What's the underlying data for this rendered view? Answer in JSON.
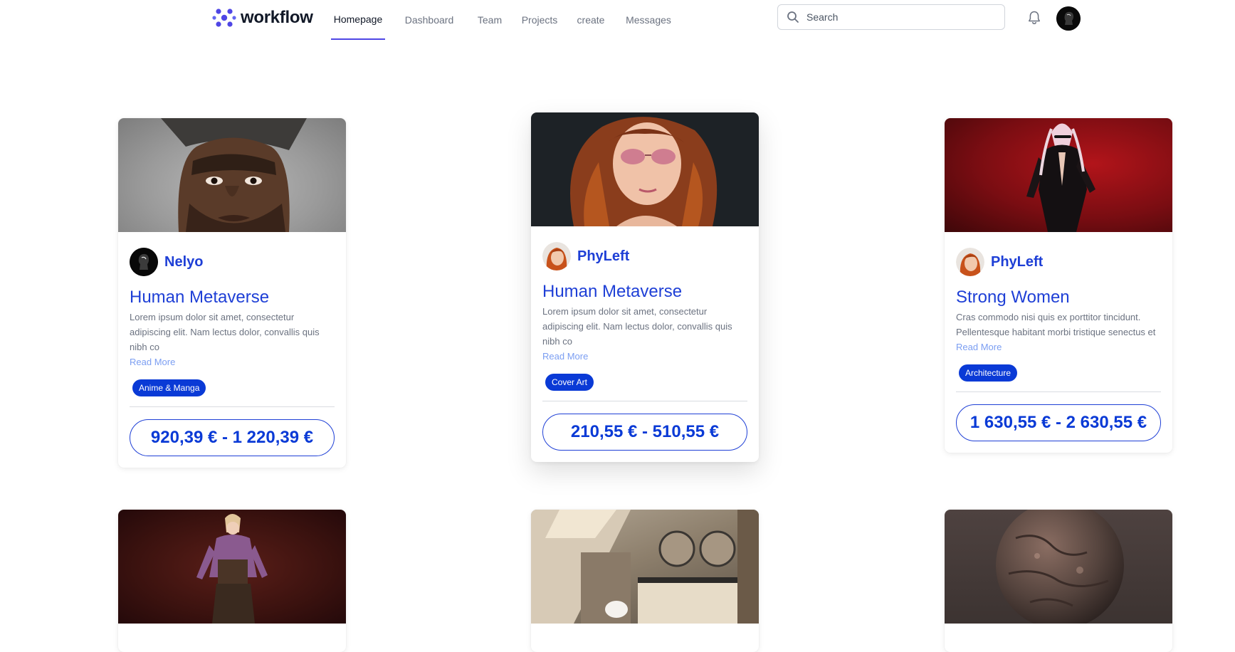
{
  "brand": {
    "name": "workflow",
    "accent": "#4f46e5"
  },
  "nav": {
    "links": [
      {
        "label": "Homepage",
        "active": true
      },
      {
        "label": "Dashboard",
        "active": false
      },
      {
        "label": "Team",
        "active": false
      },
      {
        "label": "Projects",
        "active": false
      },
      {
        "label": "create",
        "active": false
      },
      {
        "label": "Messages",
        "active": false
      }
    ],
    "search": {
      "placeholder": "Search",
      "icon": "search-icon"
    },
    "notifications_icon": "bell-icon"
  },
  "cards": [
    {
      "author": "Nelyo",
      "title": "Human Metaverse",
      "description": "Lorem ipsum dolor sit amet, consectetur adipiscing elit. Nam lectus dolor, convallis quis nibh co",
      "read_more": "Read More",
      "tag": "Anime & Manga",
      "price": "920,39 € - 1 220,39 €"
    },
    {
      "author": "PhyLeft",
      "title": "Human Metaverse",
      "description": "Lorem ipsum dolor sit amet, consectetur adipiscing elit. Nam lectus dolor, convallis quis nibh co",
      "read_more": "Read More",
      "tag": "Cover Art",
      "price": "210,55 € - 510,55 €"
    },
    {
      "author": "PhyLeft",
      "title": "Strong Women",
      "description": "Cras commodo nisi quis ex porttitor tincidunt. Pellentesque habitant morbi tristique senectus et",
      "read_more": "Read More",
      "tag": "Architecture",
      "price": "1 630,55 € - 2 630,55 €"
    }
  ],
  "colors": {
    "link_blue": "#1e3fd6",
    "tag_blue": "#0a3ad6",
    "read_more": "#7b9ef2"
  }
}
